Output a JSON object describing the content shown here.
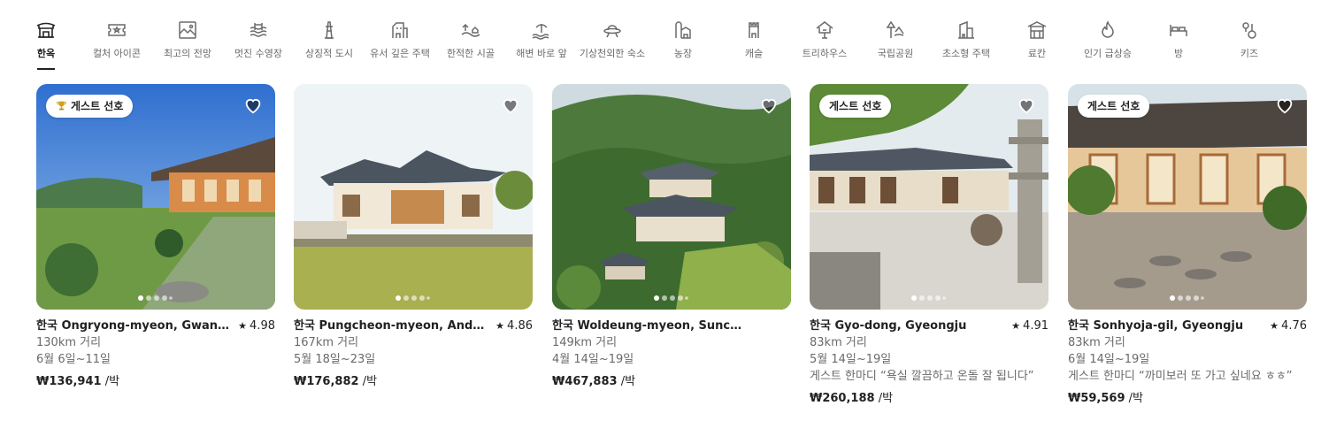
{
  "categories": [
    {
      "label": "한옥",
      "icon": "hanok-icon",
      "active": true
    },
    {
      "label": "컬처 아이콘",
      "icon": "ticket-icon",
      "active": false
    },
    {
      "label": "최고의 전망",
      "icon": "view-frame-icon",
      "active": false
    },
    {
      "label": "멋진 수영장",
      "icon": "pool-icon",
      "active": false
    },
    {
      "label": "상징적 도시",
      "icon": "tower-icon",
      "active": false
    },
    {
      "label": "유서 깊은 주택",
      "icon": "historic-house-icon",
      "active": false
    },
    {
      "label": "한적한 시골",
      "icon": "countryside-icon",
      "active": false
    },
    {
      "label": "해변 바로 앞",
      "icon": "beach-icon",
      "active": false
    },
    {
      "label": "기상천외한 숙소",
      "icon": "ufo-icon",
      "active": false
    },
    {
      "label": "농장",
      "icon": "farm-icon",
      "active": false
    },
    {
      "label": "캐슬",
      "icon": "castle-icon",
      "active": false
    },
    {
      "label": "트리하우스",
      "icon": "treehouse-icon",
      "active": false
    },
    {
      "label": "국립공원",
      "icon": "national-park-icon",
      "active": false
    },
    {
      "label": "초소형 주택",
      "icon": "tiny-house-icon",
      "active": false
    },
    {
      "label": "료칸",
      "icon": "ryokan-icon",
      "active": false
    },
    {
      "label": "인기 급상승",
      "icon": "flame-icon",
      "active": false
    },
    {
      "label": "방",
      "icon": "bed-icon",
      "active": false
    },
    {
      "label": "키즈",
      "icon": "kids-icon",
      "active": false
    }
  ],
  "listings": [
    {
      "title": "한국 Ongryong-myeon, Gwangyang-si",
      "rating": "4.98",
      "distance": "130km 거리",
      "dates": "6월 6일~11일",
      "review": "",
      "price": "₩136,941",
      "per": " /박",
      "badge": "게스트 선호",
      "badge_icon": "trophy-icon"
    },
    {
      "title": "한국 Pungcheon-myeon, Andong",
      "rating": "4.86",
      "distance": "167km 거리",
      "dates": "5월 18일~23일",
      "review": "",
      "price": "₩176,882",
      "per": " /박",
      "badge": "",
      "badge_icon": ""
    },
    {
      "title": "한국 Woldeung-myeon, Suncheon-si",
      "rating": "",
      "distance": "149km 거리",
      "dates": "4월 14일~19일",
      "review": "",
      "price": "₩467,883",
      "per": " /박",
      "badge": "",
      "badge_icon": ""
    },
    {
      "title": "한국 Gyo-dong, Gyeongju",
      "rating": "4.91",
      "distance": "83km 거리",
      "dates": "5월 14일~19일",
      "review": "게스트 한마디 “욕실 깔끔하고 온돌 잘 됩니다”",
      "price": "₩260,188",
      "per": " /박",
      "badge": "게스트 선호",
      "badge_icon": ""
    },
    {
      "title": "한국 Sonhyoja-gil, Gyeongju",
      "rating": "4.76",
      "distance": "83km 거리",
      "dates": "6월 14일~19일",
      "review": "게스트 한마디 “까미보러 또 가고 싶네요 ㅎㅎ”",
      "price": "₩59,569",
      "per": " /박",
      "badge": "게스트 선호",
      "badge_icon": ""
    }
  ],
  "colors": {
    "text": "#222222",
    "muted": "#6a6a6a",
    "heart_fill": "#3b3b3b"
  }
}
